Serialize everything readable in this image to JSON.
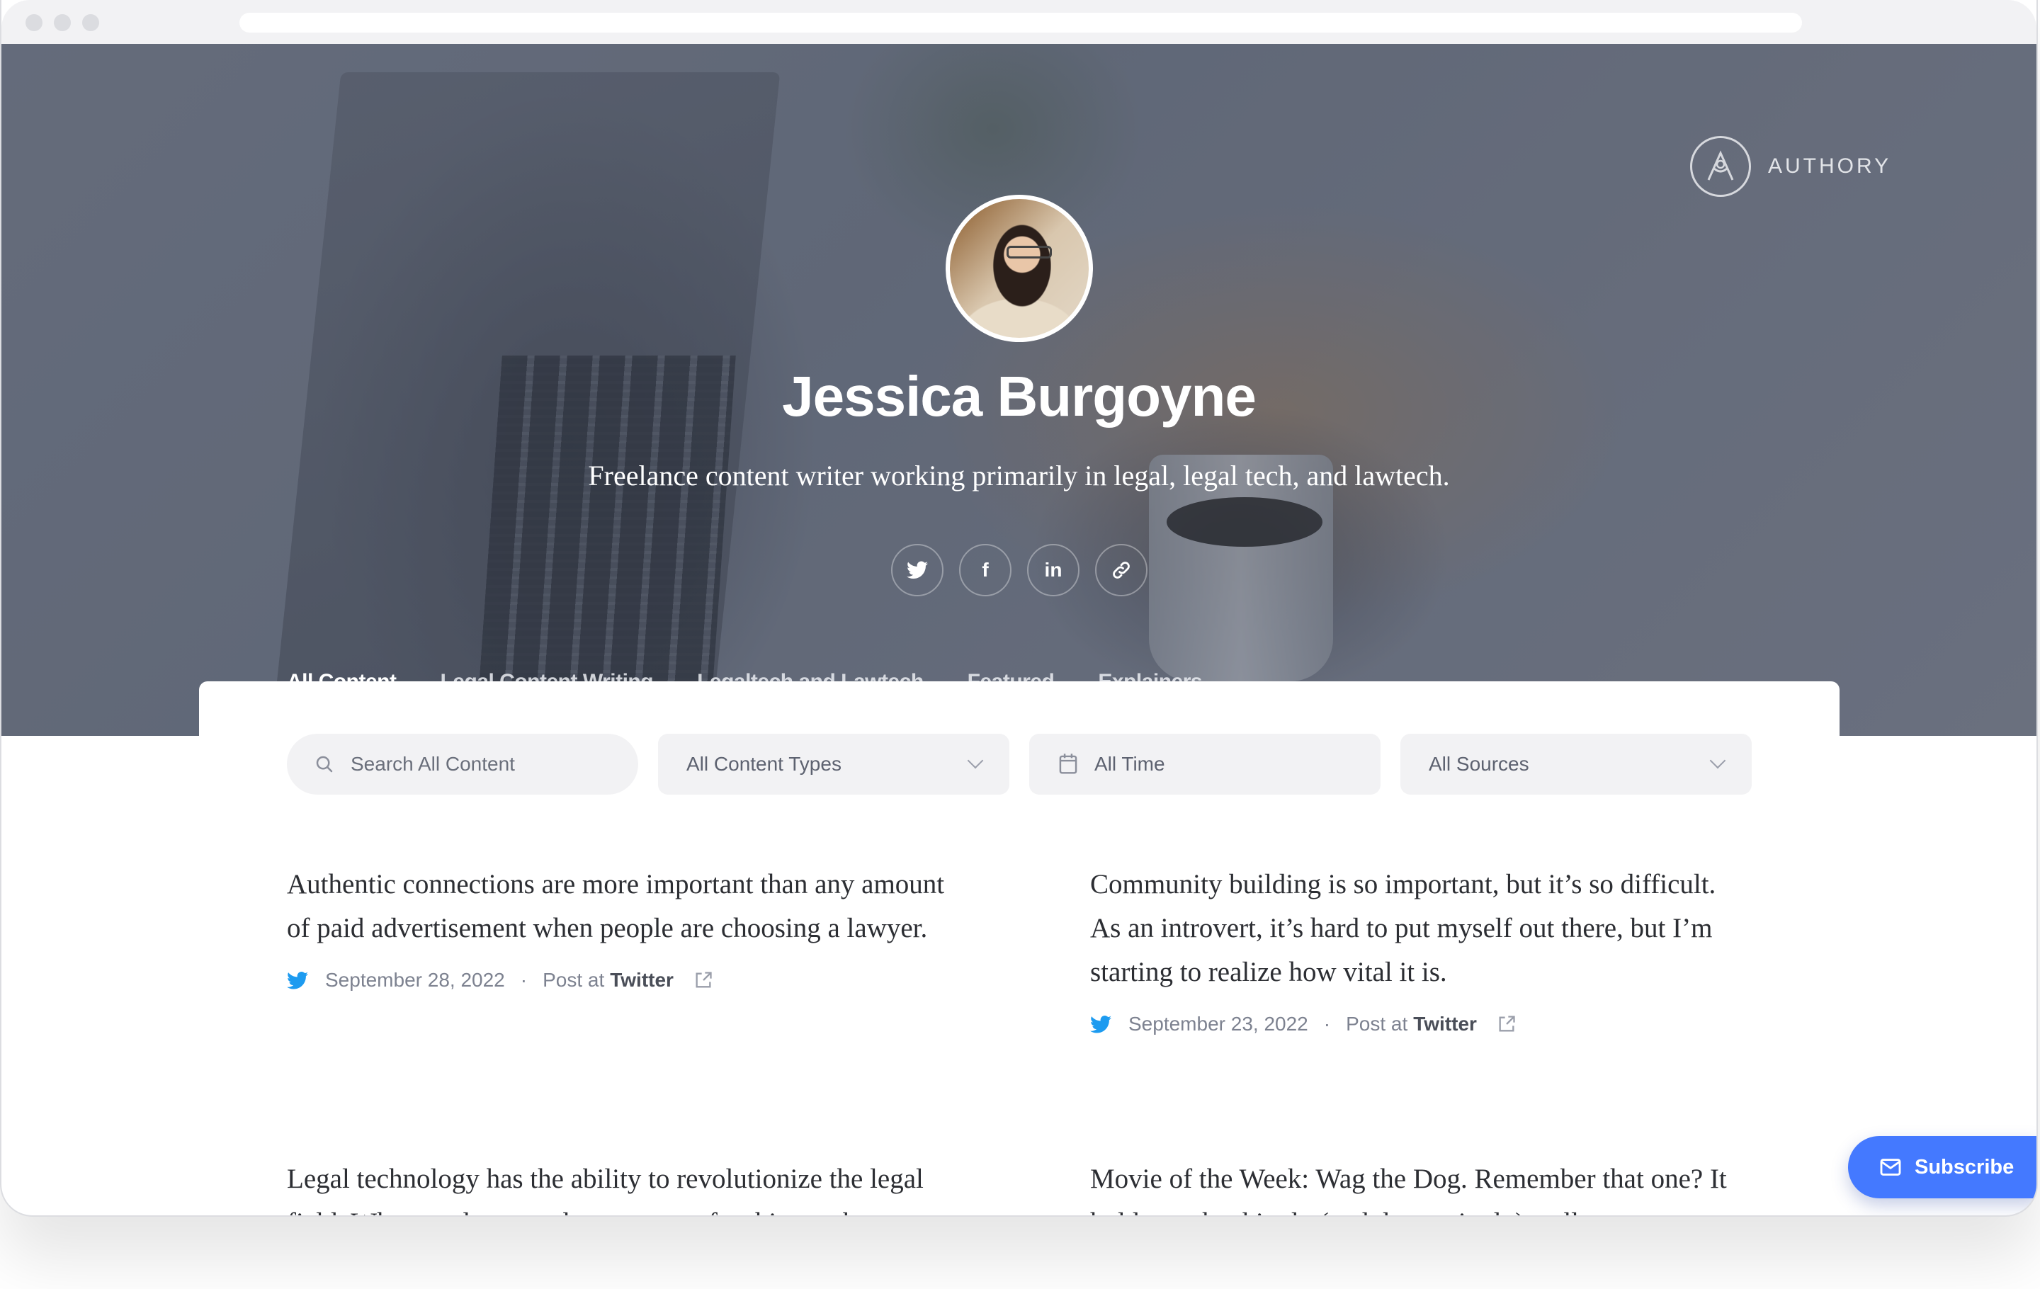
{
  "browser": {
    "window_controls": [
      "close",
      "minimize",
      "maximize"
    ]
  },
  "brand": {
    "name": "AUTHORY",
    "logo_icon": "authory-logo-icon"
  },
  "profile": {
    "name": "Jessica Burgoyne",
    "bio": "Freelance content writer working primarily in legal, legal tech, and lawtech.",
    "avatar_alt": "Jessica Burgoyne profile photo",
    "social_links": [
      {
        "name": "twitter",
        "icon": "twitter-icon"
      },
      {
        "name": "facebook",
        "icon": "facebook-icon",
        "glyph": "f"
      },
      {
        "name": "linkedin",
        "icon": "linkedin-icon",
        "glyph": "in"
      },
      {
        "name": "website",
        "icon": "link-icon"
      }
    ]
  },
  "tabs": [
    {
      "label": "All Content",
      "active": true
    },
    {
      "label": "Legal Content Writing",
      "active": false
    },
    {
      "label": "Legaltech and Lawtech",
      "active": false
    },
    {
      "label": "Featured",
      "active": false
    },
    {
      "label": "Explainers",
      "active": false
    }
  ],
  "filters": {
    "search_placeholder": "Search All Content",
    "content_type": "All Content Types",
    "time": "All Time",
    "source": "All Sources"
  },
  "posts": [
    {
      "text": "Authentic connections are more important than any amount of paid advertisement when people are choosing a lawyer.",
      "date": "September 28, 2022",
      "type_prefix": "Post at",
      "source": "Twitter",
      "separator": "·"
    },
    {
      "text": "Community building is so important, but it’s so difficult. As an introvert, it’s hard to put myself out there, but I’m starting to realize how vital it is.",
      "date": "September 23, 2022",
      "type_prefix": "Post at",
      "source": "Twitter",
      "separator": "·"
    },
    {
      "text": "Legal technology has the ability to revolutionize the legal field. What can lawyers do to prepare for this to take"
    },
    {
      "text": "Movie of the Week: Wag the Dog. Remember that one? It holds up shockingly (and depressingly) well"
    }
  ],
  "subscribe": {
    "label": "Subscribe"
  },
  "colors": {
    "accent": "#4479ff",
    "twitter": "#1d9bf0",
    "filter_bg": "#f2f2f4",
    "text": "#2c2e33",
    "meta": "#7d8290"
  }
}
